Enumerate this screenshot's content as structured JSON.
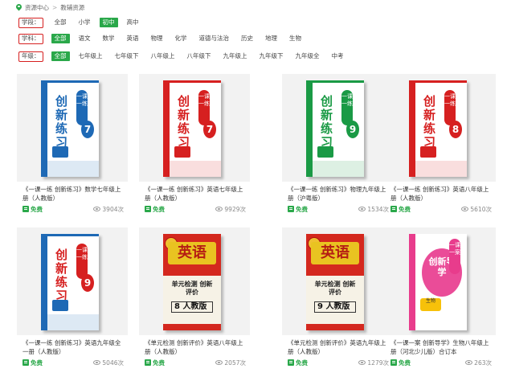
{
  "breadcrumb": {
    "home": "资源中心",
    "separator": ">",
    "current": "教辅资源"
  },
  "filters": [
    {
      "key": "学段：",
      "options": [
        "全部",
        "小学",
        "初中",
        "高中"
      ],
      "active": 2
    },
    {
      "key": "学科：",
      "options": [
        "全部",
        "语文",
        "数学",
        "英语",
        "物理",
        "化学",
        "道德与法治",
        "历史",
        "地理",
        "生物"
      ],
      "active": 0
    },
    {
      "key": "年级：",
      "options": [
        "全部",
        "七年级上",
        "七年级下",
        "八年级上",
        "八年级下",
        "九年级上",
        "九年级下",
        "九年级全",
        "中考"
      ],
      "active": 0
    }
  ],
  "books": [
    {
      "title": "《一课一练 创新练习》数学七年级上册（人教版）",
      "free": "免费",
      "views": "3904次",
      "cover": {
        "type": "cxlx",
        "spine": "#1e69b5",
        "accent": "#1e69b5",
        "grade": "7",
        "big": "创新练习",
        "badge": "一课一练"
      }
    },
    {
      "title": "《一课一练 创新练习》英语七年级上册（人教版）",
      "free": "免费",
      "views": "9929次",
      "cover": {
        "type": "cxlx",
        "spine": "#d62020",
        "accent": "#d62020",
        "grade": "7",
        "big": "创新练习",
        "badge": "一课一练"
      }
    },
    {
      "title": "《一课一练 创新练习》物理九年级上册（沪粤版）",
      "free": "免费",
      "views": "1534次",
      "cover": {
        "type": "cxlx",
        "spine": "#1a9a45",
        "accent": "#1a9a45",
        "grade": "9",
        "big": "创新练习",
        "badge": "一课一练"
      }
    },
    {
      "title": "《一课一练 创新练习》英语八年级上册（人教版）",
      "free": "免费",
      "views": "5610次",
      "cover": {
        "type": "cxlx",
        "spine": "#d62020",
        "accent": "#d62020",
        "grade": "8",
        "big": "创新练习",
        "badge": "一课一练"
      }
    },
    {
      "title": "《一课一练 创新练习》英语九年级全一册（人教版）",
      "free": "免费",
      "views": "5046次",
      "cover": {
        "type": "cxlx",
        "spine": "#1e69b5",
        "accent": "#d62020",
        "grade": "9",
        "big": "创新练习",
        "badge": "一课一练"
      }
    },
    {
      "title": "《单元检测 创新评价》英语八年级上册（人教版）",
      "free": "免费",
      "views": "2057次",
      "cover": {
        "type": "eng",
        "word": "英语",
        "sub": "单元检测 创新评价",
        "num": "8 人教版"
      }
    },
    {
      "title": "《单元检测 创新评价》英语九年级上册（人教版）",
      "free": "免费",
      "views": "1279次",
      "cover": {
        "type": "eng",
        "word": "英语",
        "sub": "单元检测 创新评价",
        "num": "9 人教版"
      }
    },
    {
      "title": "《一课一案 创新导学》生物八年级上册（河北少儿版）合订本",
      "free": "免费",
      "views": "263次",
      "cover": {
        "type": "pink",
        "big": "创新导学",
        "badge": "一课一案",
        "tag": "生物"
      }
    }
  ],
  "colors": {
    "accent_green": "#2aa84a",
    "filter_border": "#d62020"
  }
}
